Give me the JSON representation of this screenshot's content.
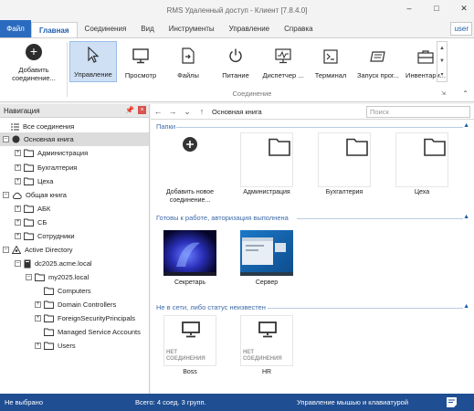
{
  "window": {
    "title": "RMS Удаленный доступ - Клиент [7.8.4.0]"
  },
  "menu": {
    "file": "Файл",
    "tabs": [
      "Главная",
      "Соединения",
      "Вид",
      "Инструменты",
      "Управление",
      "Справка"
    ],
    "active_tab": "Главная",
    "user": "user"
  },
  "ribbon": {
    "add_label": "Добавить соединение...",
    "buttons": [
      "Управление",
      "Просмотр",
      "Файлы",
      "Питание",
      "Диспетчер ...",
      "Терминал",
      "Запуск прог...",
      "Инвентари..."
    ],
    "group_name": "Соединение"
  },
  "nav": {
    "title": "Навигация",
    "items": [
      "Все соединения",
      "Основная книга",
      "Администрация",
      "Бухгалтерия",
      "Цеха",
      "Общая книга",
      "АБК",
      "СБ",
      "Сотрудники",
      "Active Directory",
      "dc2025.acme.local",
      "my2025.local",
      "Computers",
      "Domain Controllers",
      "ForeignSecurityPrincipals",
      "Managed Service Accounts",
      "Users"
    ]
  },
  "address": {
    "path": "Основная книга",
    "search_placeholder": "Поиск"
  },
  "content": {
    "folders_title": "Папки",
    "folders": [
      "Добавить новое соединение...",
      "Администрация",
      "Бухгалтерия",
      "Цеха"
    ],
    "ready_title": "Готовы к работе, авторизация выполнена",
    "ready": [
      "Секретарь",
      "Сервер"
    ],
    "offline_title": "Не в сети, либо статус неизвестен",
    "offline_badge": "НЕТ СОЕДИНЕНИЯ",
    "offline": [
      "Boss",
      "HR"
    ]
  },
  "status": {
    "left": "Не выбрано",
    "center": "Всего: 4 соед. 3 групп.",
    "right": "Управление мышью и клавиатурой"
  }
}
